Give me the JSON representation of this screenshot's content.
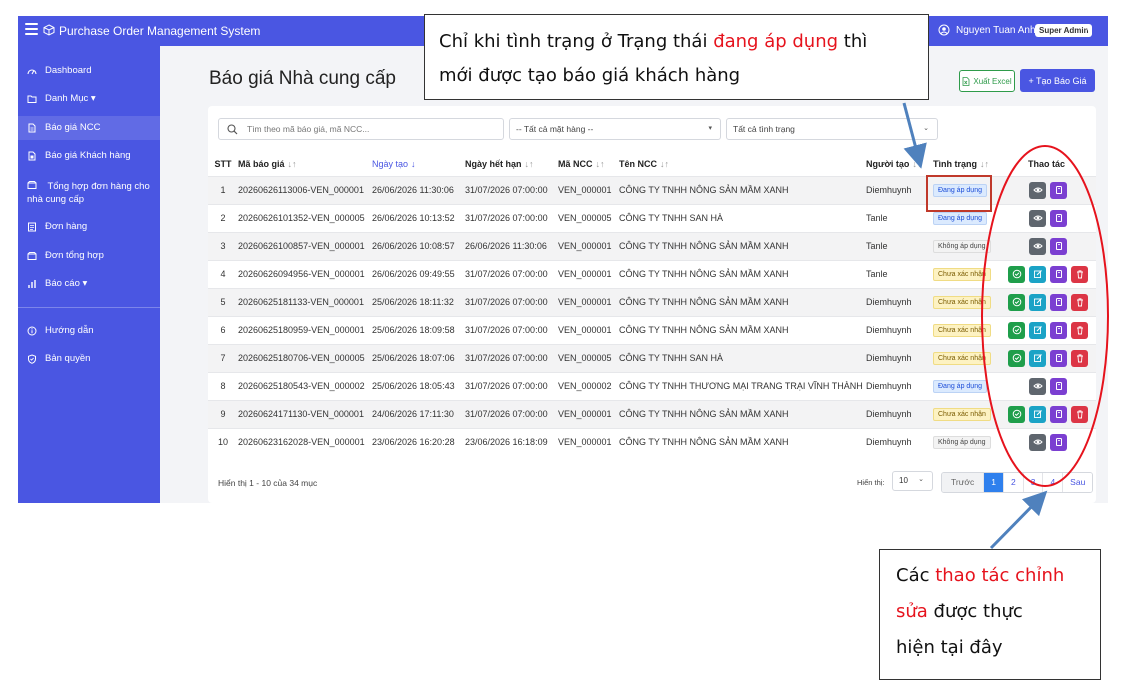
{
  "app": {
    "title": "Purchase Order Management System",
    "user_name": "Nguyen Tuan Anh",
    "role": "Super Admin",
    "brand_color": "#4a56e2"
  },
  "sidebar": {
    "items": [
      {
        "label": "Dashboard",
        "icon": "dashboard-icon"
      },
      {
        "label": "Danh Mục ▾",
        "icon": "folder-icon"
      },
      {
        "label": "Báo giá NCC",
        "icon": "document-icon",
        "active": true
      },
      {
        "label": "Báo giá Khách hàng",
        "icon": "document-icon"
      },
      {
        "label": "Tổng hợp đơn hàng cho nhà cung cấp",
        "icon": "box-icon"
      },
      {
        "label": "Đơn hàng",
        "icon": "list-icon"
      },
      {
        "label": "Đơn tổng hợp",
        "icon": "box-icon"
      },
      {
        "label": "Báo cáo ▾",
        "icon": "bar-chart-icon"
      },
      {
        "label": "Hướng dẫn",
        "icon": "info-icon"
      },
      {
        "label": "Bản quyền",
        "icon": "shield-icon"
      }
    ]
  },
  "page": {
    "title": "Báo giá Nhà cung cấp",
    "excel_label": "Xuất Excel",
    "create_label": "+ Tạo Báo Giá"
  },
  "filters": {
    "search_placeholder": "Tìm theo mã báo giá, mã NCC...",
    "item_select": "-- Tất cả mặt hàng --",
    "status_select": "Tất cả tình trạng"
  },
  "table": {
    "headers": [
      "STT",
      "Mã báo giá",
      "Ngày tạo",
      "Ngày hết hạn",
      "Mã NCC",
      "Tên NCC",
      "Người tạo",
      "Tình trạng",
      "Thao tác"
    ],
    "rows": [
      {
        "stt": "1",
        "code": "20260626113006-VEN_000001",
        "created": "26/06/2026 11:30:06",
        "expires": "31/07/2026 07:00:00",
        "vendor_code": "VEN_000001",
        "vendor_name": "CÔNG TY TNHH NÔNG SẢN MẦM XANH",
        "creator": "Diemhuynh",
        "status": "Đang áp dụng",
        "status_kind": "active"
      },
      {
        "stt": "2",
        "code": "20260626101352-VEN_000005",
        "created": "26/06/2026 10:13:52",
        "expires": "31/07/2026 07:00:00",
        "vendor_code": "VEN_000005",
        "vendor_name": "CÔNG TY TNHH SAN HÀ",
        "creator": "Tanle",
        "status": "Đang áp dụng",
        "status_kind": "active"
      },
      {
        "stt": "3",
        "code": "20260626100857-VEN_000001",
        "created": "26/06/2026 10:08:57",
        "expires": "26/06/2026 11:30:06",
        "vendor_code": "VEN_000001",
        "vendor_name": "CÔNG TY TNHH NÔNG SẢN MẦM XANH",
        "creator": "Tanle",
        "status": "Không áp dụng",
        "status_kind": "inactive"
      },
      {
        "stt": "4",
        "code": "20260626094956-VEN_000001",
        "created": "26/06/2026 09:49:55",
        "expires": "31/07/2026 07:00:00",
        "vendor_code": "VEN_000001",
        "vendor_name": "CÔNG TY TNHH NÔNG SẢN MẦM XANH",
        "creator": "Tanle",
        "status": "Chưa xác nhận",
        "status_kind": "pending"
      },
      {
        "stt": "5",
        "code": "20260625181133-VEN_000001",
        "created": "25/06/2026 18:11:32",
        "expires": "31/07/2026 07:00:00",
        "vendor_code": "VEN_000001",
        "vendor_name": "CÔNG TY TNHH NÔNG SẢN MẦM XANH",
        "creator": "Diemhuynh",
        "status": "Chưa xác nhận",
        "status_kind": "pending"
      },
      {
        "stt": "6",
        "code": "20260625180959-VEN_000001",
        "created": "25/06/2026 18:09:58",
        "expires": "31/07/2026 07:00:00",
        "vendor_code": "VEN_000001",
        "vendor_name": "CÔNG TY TNHH NÔNG SẢN MẦM XANH",
        "creator": "Diemhuynh",
        "status": "Chưa xác nhận",
        "status_kind": "pending"
      },
      {
        "stt": "7",
        "code": "20260625180706-VEN_000005",
        "created": "25/06/2026 18:07:06",
        "expires": "31/07/2026 07:00:00",
        "vendor_code": "VEN_000005",
        "vendor_name": "CÔNG TY TNHH SAN HÀ",
        "creator": "Diemhuynh",
        "status": "Chưa xác nhận",
        "status_kind": "pending"
      },
      {
        "stt": "8",
        "code": "20260625180543-VEN_000002",
        "created": "25/06/2026 18:05:43",
        "expires": "31/07/2026 07:00:00",
        "vendor_code": "VEN_000002",
        "vendor_name": "CÔNG TY TNHH THƯƠNG MẠI TRANG TRẠI VĨNH THÀNH",
        "creator": "Diemhuynh",
        "status": "Đang áp dụng",
        "status_kind": "active"
      },
      {
        "stt": "9",
        "code": "20260624171130-VEN_000001",
        "created": "24/06/2026 17:11:30",
        "expires": "31/07/2026 07:00:00",
        "vendor_code": "VEN_000001",
        "vendor_name": "CÔNG TY TNHH NÔNG SẢN MẦM XANH",
        "creator": "Diemhuynh",
        "status": "Chưa xác nhận",
        "status_kind": "pending"
      },
      {
        "stt": "10",
        "code": "20260623162028-VEN_000001",
        "created": "23/06/2026 16:20:28",
        "expires": "23/06/2026 16:18:09",
        "vendor_code": "VEN_000001",
        "vendor_name": "CÔNG TY TNHH NÔNG SẢN MẦM XANH",
        "creator": "Diemhuynh",
        "status": "Không áp dụng",
        "status_kind": "inactive"
      }
    ]
  },
  "footer": {
    "info": "Hiển thị 1 - 10 của 34 mục",
    "per_page_label": "Hiển thị:",
    "per_page": "10",
    "pages": [
      "Trước",
      "1",
      "2",
      "3",
      "4",
      "Sau"
    ],
    "current_page": "1"
  },
  "annotations": {
    "top": {
      "line1_a": "Chỉ khi tình trạng ở Trạng thái ",
      "line1_red": "đang áp dụng",
      "line1_b": " thì",
      "line2": "mới được tạo báo giá khách hàng"
    },
    "bottom": {
      "line1_a": "Các ",
      "line1_red": "thao tác chỉnh",
      "line2_red": "sửa",
      "line2_b": " được thực",
      "line3": "hiện tại đây"
    },
    "box_color": "#c0392b",
    "ellipse_color": "#e6131d",
    "arrow_color": "#4f81bd"
  }
}
